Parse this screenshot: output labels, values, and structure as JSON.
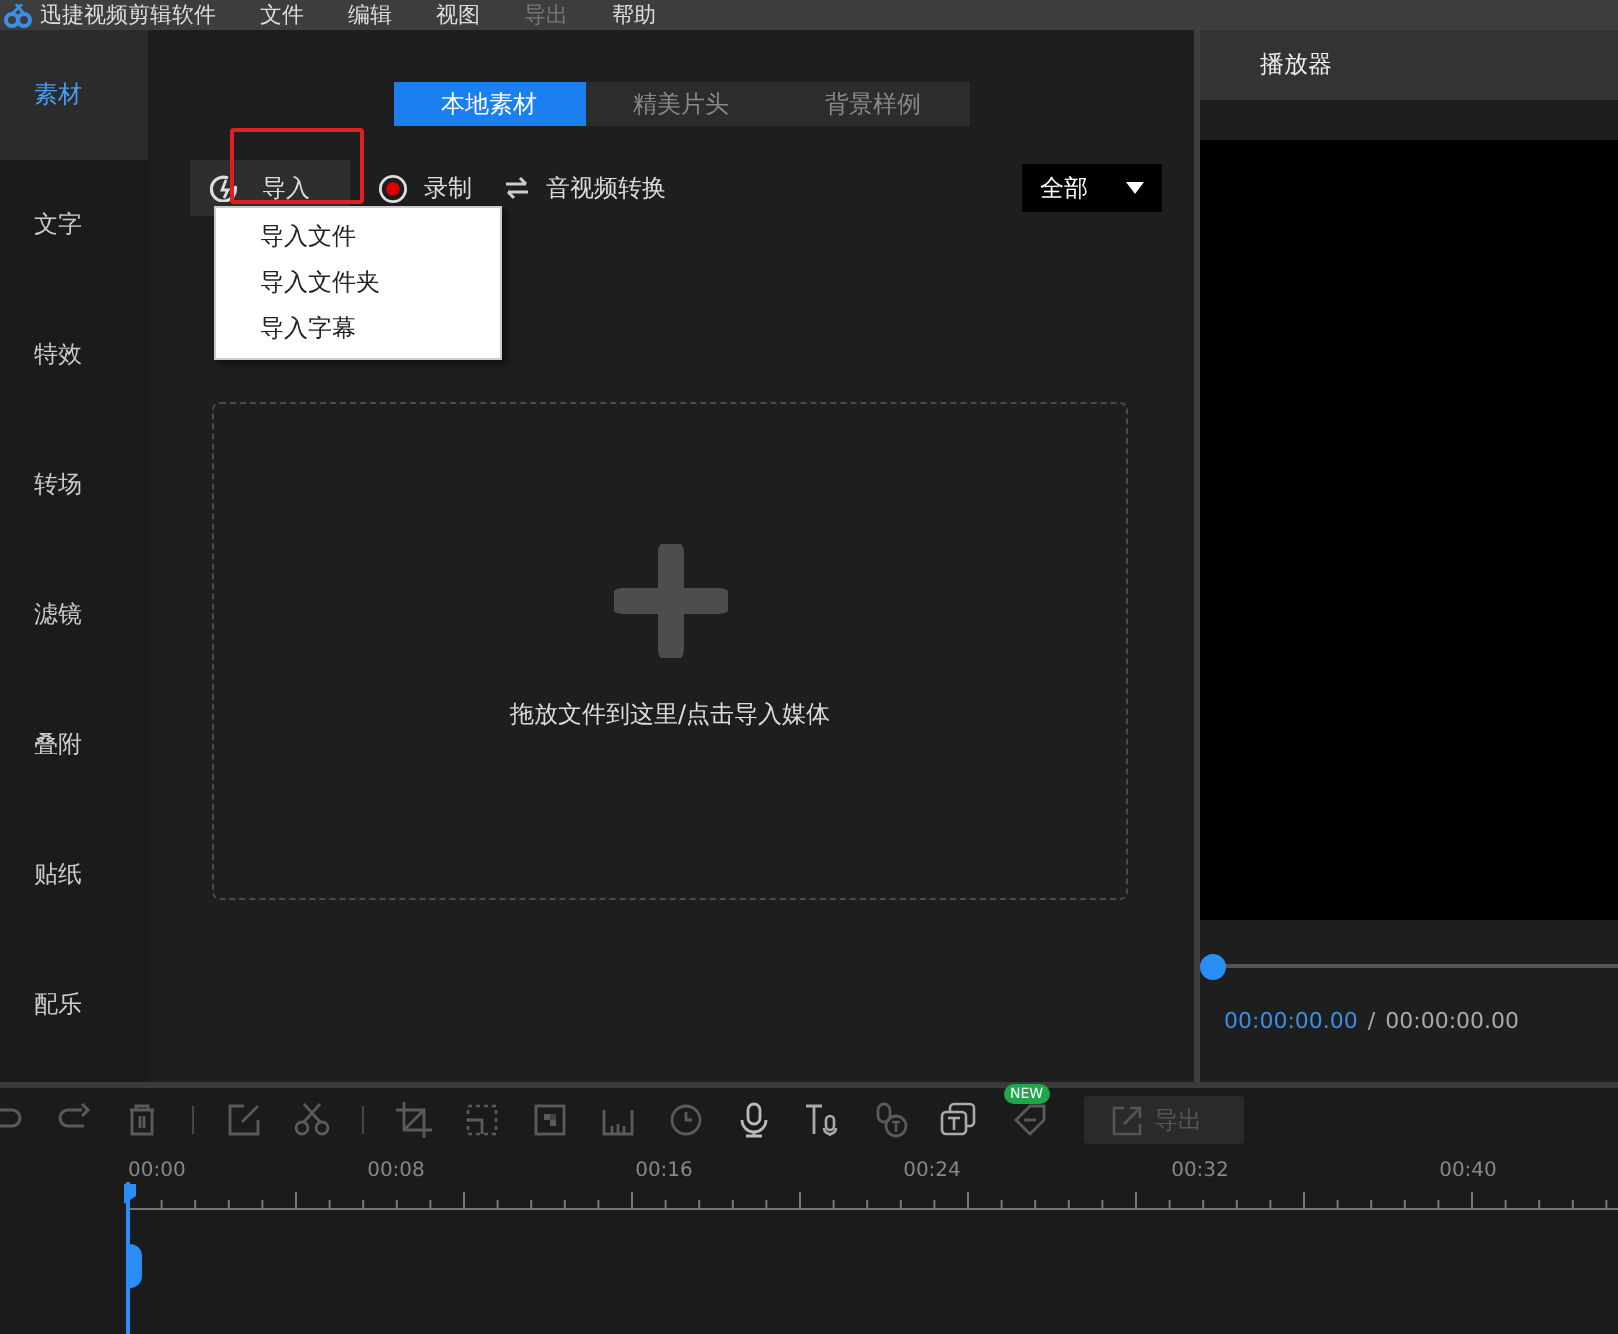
{
  "menu_bar": {
    "app_title": "迅捷视频剪辑软件",
    "items": [
      {
        "label": "文件",
        "disabled": false
      },
      {
        "label": "编辑",
        "disabled": false
      },
      {
        "label": "视图",
        "disabled": false
      },
      {
        "label": "导出",
        "disabled": true
      },
      {
        "label": "帮助",
        "disabled": false
      }
    ]
  },
  "sidebar": {
    "items": [
      {
        "label": "素材",
        "selected": true
      },
      {
        "label": "文字",
        "selected": false
      },
      {
        "label": "特效",
        "selected": false
      },
      {
        "label": "转场",
        "selected": false
      },
      {
        "label": "滤镜",
        "selected": false
      },
      {
        "label": "叠附",
        "selected": false
      },
      {
        "label": "贴纸",
        "selected": false
      },
      {
        "label": "配乐",
        "selected": false
      }
    ]
  },
  "media": {
    "tabs": [
      {
        "label": "本地素材",
        "selected": true
      },
      {
        "label": "精美片头",
        "selected": false
      },
      {
        "label": "背景样例",
        "selected": false
      }
    ],
    "actions": {
      "import": "导入",
      "record": "录制",
      "convert": "音视频转换"
    },
    "filter": {
      "value": "全部"
    },
    "import_menu": {
      "items": [
        "导入文件",
        "导入文件夹",
        "导入字幕"
      ]
    },
    "drop_zone": {
      "text": "拖放文件到这里/点击导入媒体"
    }
  },
  "player": {
    "title": "播放器",
    "progress": {
      "level": 0
    },
    "current_time": "00:00:00.00",
    "separator": "/",
    "total_time": "00:00:00.00"
  },
  "timeline": {
    "badge": "NEW",
    "export": {
      "label": "导出",
      "disabled": true
    },
    "ruler": [
      "00:00",
      "00:08",
      "00:16",
      "00:24",
      "00:32",
      "00:40"
    ]
  }
}
